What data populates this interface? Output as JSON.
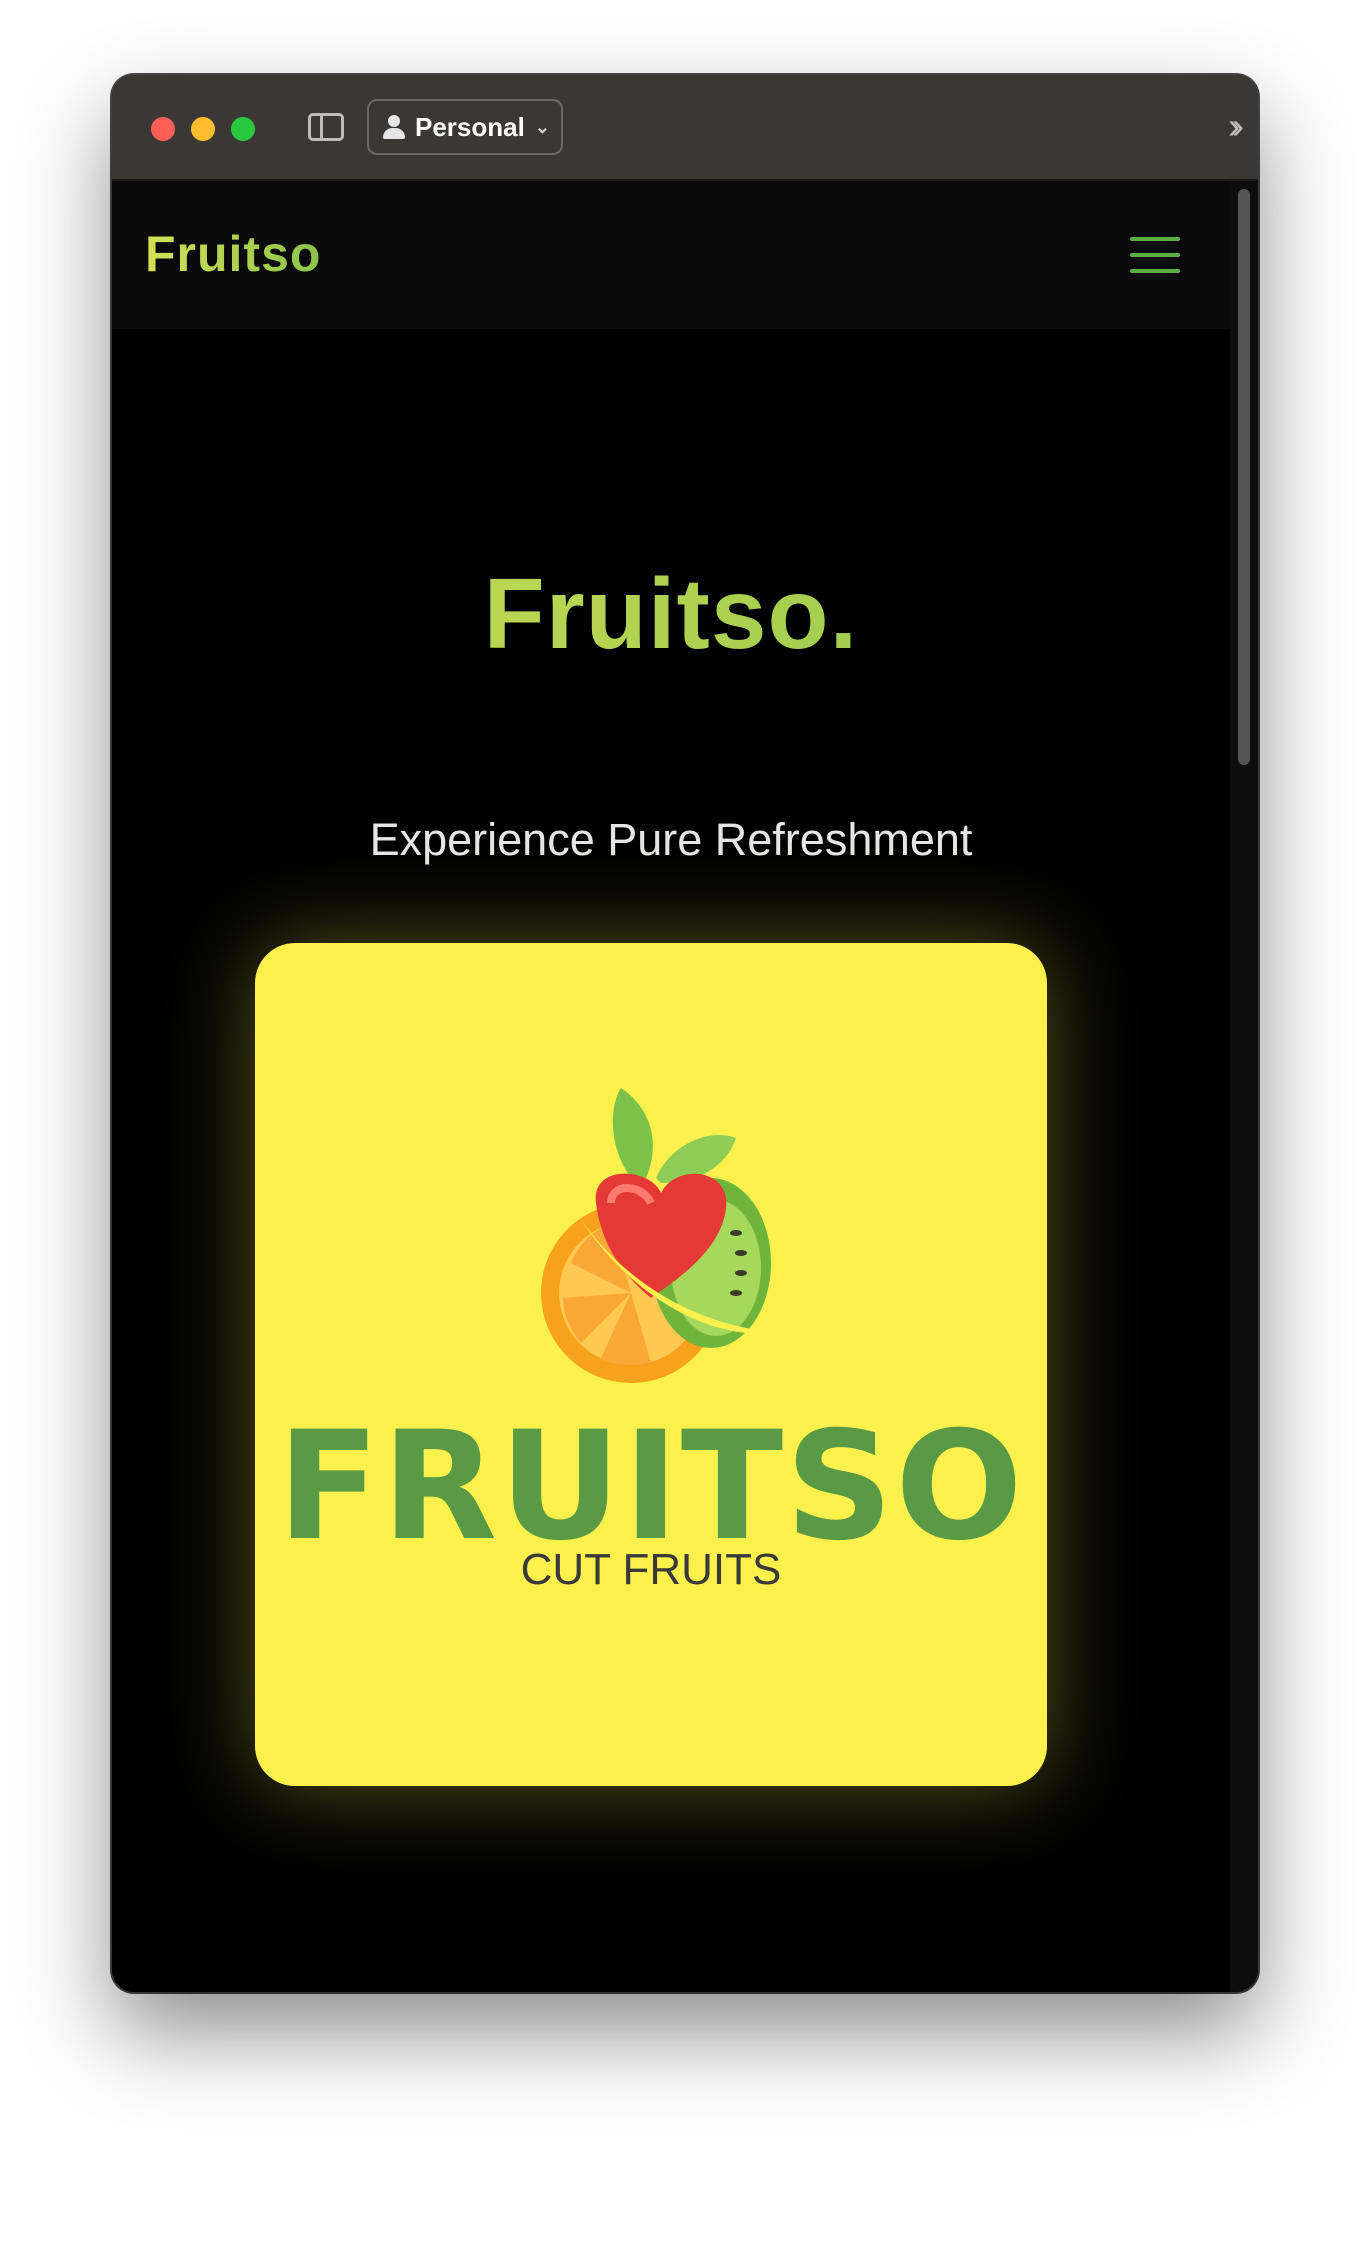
{
  "browser": {
    "profile_label": "Personal",
    "more_icon": "double-chevron-right-icon"
  },
  "site": {
    "brand": "Fruitso",
    "menu_icon": "hamburger-menu-icon"
  },
  "hero": {
    "title": "Fruitso.",
    "tagline": "Experience Pure Refreshment"
  },
  "logo": {
    "wordmark": "FRUITSO",
    "subtitle": "CUT FRUITS"
  },
  "colors": {
    "accent_yellow": "#fcf04d",
    "brand_green": "#5a9a45",
    "brand_gradient_start": "#d4e157",
    "brand_gradient_end": "#8bc34a",
    "menu_green": "#5cae44"
  }
}
